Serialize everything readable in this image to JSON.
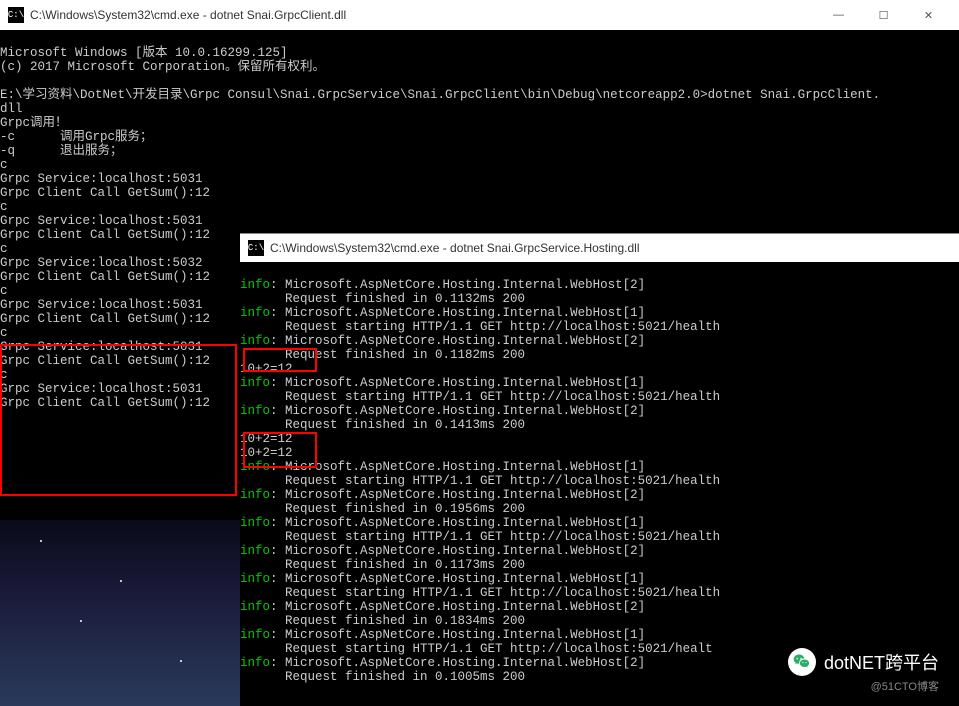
{
  "window1": {
    "title": "C:\\Windows\\System32\\cmd.exe - dotnet  Snai.GrpcClient.dll",
    "icon_label": "C:\\"
  },
  "window2": {
    "title": "C:\\Windows\\System32\\cmd.exe - dotnet  Snai.GrpcService.Hosting.dll",
    "icon_label": "C:\\"
  },
  "win_controls": {
    "min": "—",
    "max": "☐",
    "close": "✕"
  },
  "terminal1": {
    "line1": "Microsoft Windows [版本 10.0.16299.125]",
    "line2": "(c) 2017 Microsoft Corporation。保留所有权利。",
    "line3": "",
    "line4": "E:\\学习资料\\DotNet\\开发目录\\Grpc Consul\\Snai.GrpcService\\Snai.GrpcClient\\bin\\Debug\\netcoreapp2.0>dotnet Snai.GrpcClient.",
    "line5": "dll",
    "line6": "Grpc调用！",
    "line7": "-c      调用Grpc服务；",
    "line8": "-q      退出服务；",
    "line9": "c",
    "line10": "Grpc Service:localhost:5031",
    "line11": "Grpc Client Call GetSum():12",
    "line12": "c",
    "line13": "Grpc Service:localhost:5031",
    "line14": "Grpc Client Call GetSum():12",
    "line15": "c",
    "line16": "Grpc Service:localhost:5032",
    "line17": "Grpc Client Call GetSum():12",
    "line18": "c",
    "line19": "Grpc Service:localhost:5031",
    "line20": "Grpc Client Call GetSum():12",
    "line21": "c",
    "line22": "Grpc Service:localhost:5031",
    "line23": "Grpc Client Call GetSum():12",
    "line24": "c",
    "line25": "Grpc Service:localhost:5031",
    "line26": "Grpc Client Call GetSum():12"
  },
  "terminal2": {
    "info": "info",
    "l1": ": Microsoft.AspNetCore.Hosting.Internal.WebHost[2]",
    "l2": "      Request finished in 0.1132ms 200",
    "l3": ": Microsoft.AspNetCore.Hosting.Internal.WebHost[1]",
    "l4": "      Request starting HTTP/1.1 GET http://localhost:5021/health",
    "l5": ": Microsoft.AspNetCore.Hosting.Internal.WebHost[2]",
    "l6": "      Request finished in 0.1182ms 200",
    "l7": "10+2=12",
    "l8": ": Microsoft.AspNetCore.Hosting.Internal.WebHost[1]",
    "l9": "      Request starting HTTP/1.1 GET http://localhost:5021/health",
    "l10": ": Microsoft.AspNetCore.Hosting.Internal.WebHost[2]",
    "l11": "      Request finished in 0.1413ms 200",
    "l12": "10+2=12",
    "l13": "10+2=12",
    "l14": ": Microsoft.AspNetCore.Hosting.Internal.WebHost[1]",
    "l15": "      Request starting HTTP/1.1 GET http://localhost:5021/health",
    "l16": ": Microsoft.AspNetCore.Hosting.Internal.WebHost[2]",
    "l17": "      Request finished in 0.1956ms 200",
    "l18": ": Microsoft.AspNetCore.Hosting.Internal.WebHost[1]",
    "l19": "      Request starting HTTP/1.1 GET http://localhost:5021/health",
    "l20": ": Microsoft.AspNetCore.Hosting.Internal.WebHost[2]",
    "l21": "      Request finished in 0.1173ms 200",
    "l22": ": Microsoft.AspNetCore.Hosting.Internal.WebHost[1]",
    "l23": "      Request starting HTTP/1.1 GET http://localhost:5021/health",
    "l24": ": Microsoft.AspNetCore.Hosting.Internal.WebHost[2]",
    "l25": "      Request finished in 0.1834ms 200",
    "l26": ": Microsoft.AspNetCore.Hosting.Internal.WebHost[1]",
    "l27": "      Request starting HTTP/1.1 GET http://localhost:5021/healt",
    "l28": ": Microsoft.AspNetCore.Hosting.Internal.WebHost[2]",
    "l29": "      Request finished in 0.1005ms 200"
  },
  "watermark": {
    "text": "dotNET跨平台",
    "sub": "@51CTO博客"
  }
}
